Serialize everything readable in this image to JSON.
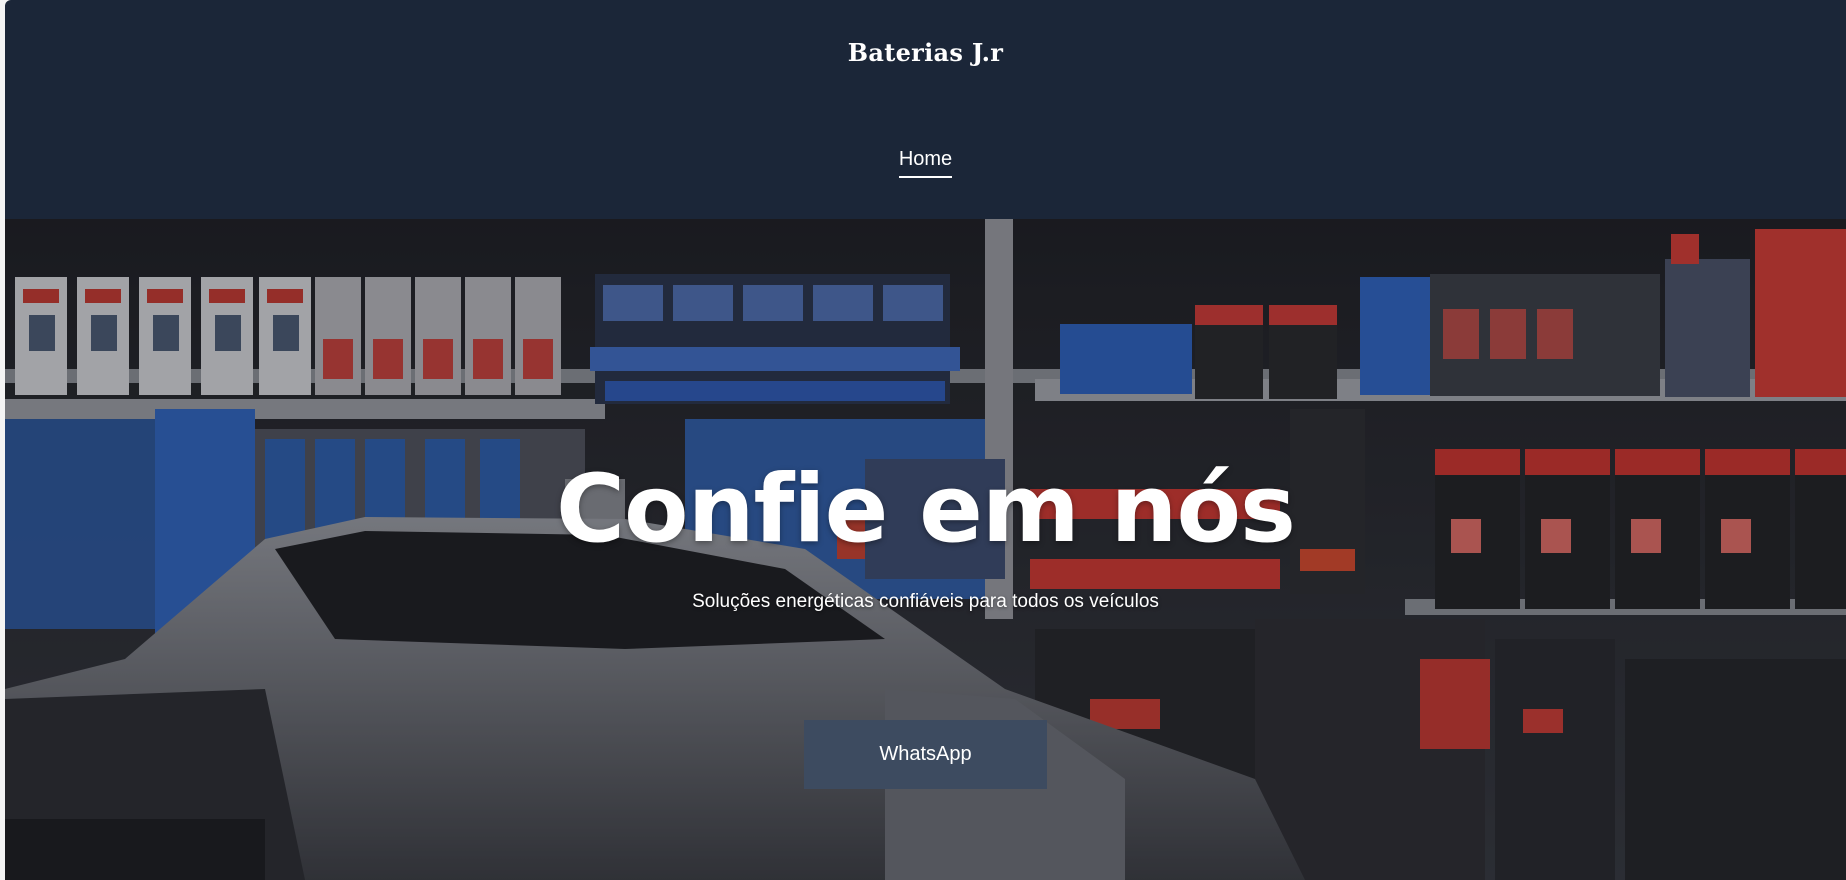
{
  "header": {
    "brand": "Baterias J.r",
    "nav": [
      {
        "label": "Home"
      }
    ]
  },
  "hero": {
    "title": "Confie em nós",
    "subtitle": "Soluções energéticas confiáveis para todos os veículos",
    "cta_label": "WhatsApp"
  },
  "colors": {
    "header_bg": "#1b2638",
    "cta_bg": "#3d4b60",
    "text": "#ffffff"
  }
}
